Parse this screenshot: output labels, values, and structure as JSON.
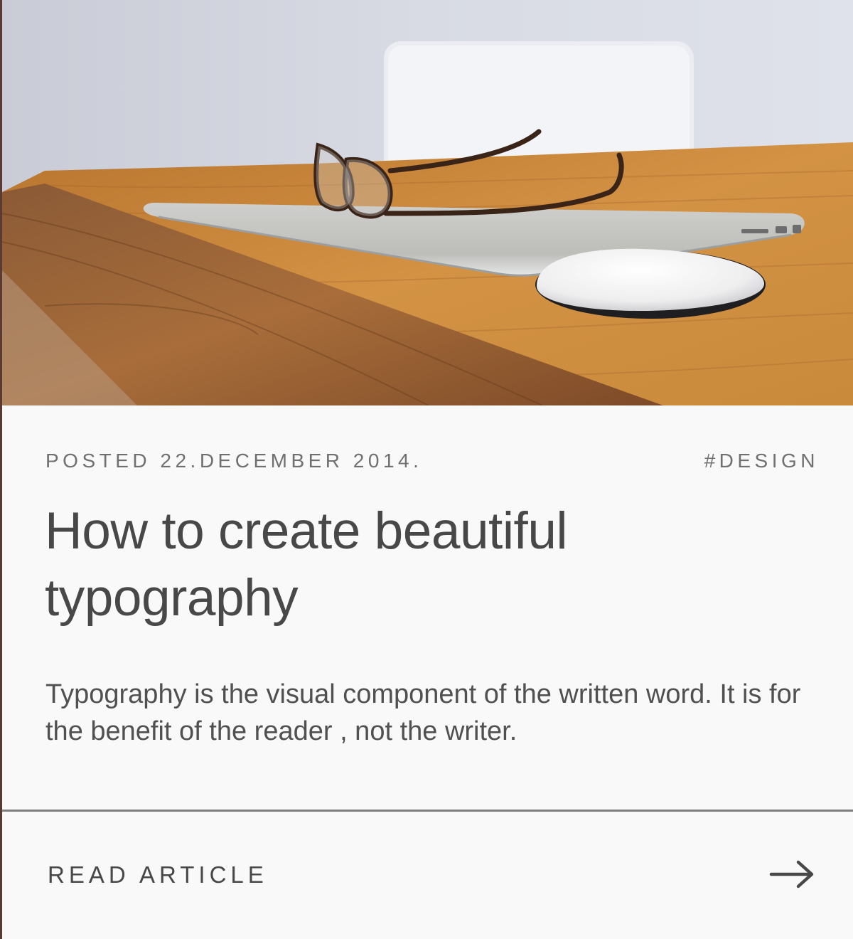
{
  "card": {
    "hero_alt": "Laptop, glasses and mouse on a wooden desk",
    "meta": {
      "posted": "POSTED 22.DECEMBER 2014.",
      "tag": "#DESIGN"
    },
    "title": "How to create beautiful typography",
    "excerpt": "Typography is the visual component of the written word. It is for the benefit of the reader , not the writer.",
    "cta": {
      "label": "READ ARTICLE",
      "icon": "arrow-right-icon"
    }
  },
  "colors": {
    "card_background": "#f9f9f9",
    "page_background": "#5a3a32",
    "title_text": "#484848",
    "meta_text": "#707070",
    "divider": "#808080"
  }
}
